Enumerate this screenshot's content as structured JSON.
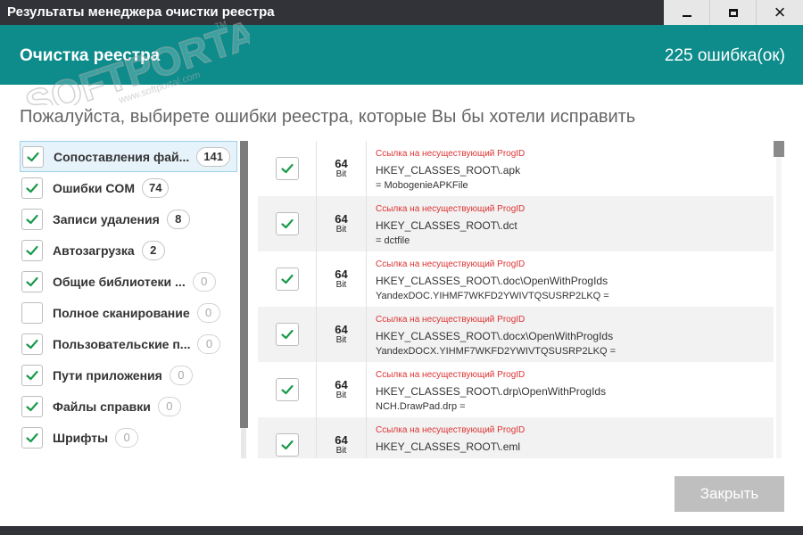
{
  "window": {
    "title": "Результаты менеджера очистки реестра",
    "controls": {
      "minimize": "minimize-icon",
      "maximize": "maximize-icon",
      "close": "×"
    }
  },
  "header": {
    "title": "Очистка реестра",
    "error_count": "225 ошибка(ок)"
  },
  "watermark": {
    "brand": "SOFTPORTAL",
    "url": "www.softportal.com",
    "tm": "TM"
  },
  "prompt": "Пожалуйста, выбирете ошибки реестра, которые Вы бы хотели исправить",
  "categories": [
    {
      "label": "Сопоставления фай...",
      "count": "141",
      "checked": true,
      "selected": true
    },
    {
      "label": "Ошибки COM",
      "count": "74",
      "checked": true
    },
    {
      "label": "Записи удаления",
      "count": "8",
      "checked": true
    },
    {
      "label": "Автозагрузка",
      "count": "2",
      "checked": true
    },
    {
      "label": "Общие библиотеки ...",
      "count": "0",
      "checked": true
    },
    {
      "label": "Полное сканирование",
      "count": "0",
      "checked": false
    },
    {
      "label": "Пользовательские п...",
      "count": "0",
      "checked": true
    },
    {
      "label": "Пути приложения",
      "count": "0",
      "checked": true
    },
    {
      "label": "Файлы справки",
      "count": "0",
      "checked": true
    },
    {
      "label": "Шрифты",
      "count": "0",
      "checked": true
    }
  ],
  "errors": [
    {
      "type": "Ссылка на несуществующий ProgID",
      "bits": "64",
      "bit_label": "Bit",
      "key": "HKEY_CLASSES_ROOT\\.apk",
      "value": " = MobogenieAPKFile"
    },
    {
      "type": "Ссылка на несуществующий ProgID",
      "bits": "64",
      "bit_label": "Bit",
      "key": "HKEY_CLASSES_ROOT\\.dct",
      "value": " = dctfile"
    },
    {
      "type": "Ссылка на несуществующий ProgID",
      "bits": "64",
      "bit_label": "Bit",
      "key": "HKEY_CLASSES_ROOT\\.doc\\OpenWithProgIds",
      "value": "YandexDOC.YIHMF7WKFD2YWIVTQSUSRP2LKQ ="
    },
    {
      "type": "Ссылка на несуществующий ProgID",
      "bits": "64",
      "bit_label": "Bit",
      "key": "HKEY_CLASSES_ROOT\\.docx\\OpenWithProgIds",
      "value": "YandexDOCX.YIHMF7WKFD2YWIVTQSUSRP2LKQ ="
    },
    {
      "type": "Ссылка на несуществующий ProgID",
      "bits": "64",
      "bit_label": "Bit",
      "key": "HKEY_CLASSES_ROOT\\.drp\\OpenWithProgIds",
      "value": "NCH.DrawPad.drp ="
    },
    {
      "type": "Ссылка на несуществующий ProgID",
      "bits": "64",
      "bit_label": "Bit",
      "key": "HKEY_CLASSES_ROOT\\.eml",
      "value": ""
    }
  ],
  "footer": {
    "close_label": "Закрыть"
  },
  "colors": {
    "accent": "#0e8b8b",
    "titlebar": "#313338",
    "check": "#1a9a4a",
    "error_type": "#dd3333"
  }
}
